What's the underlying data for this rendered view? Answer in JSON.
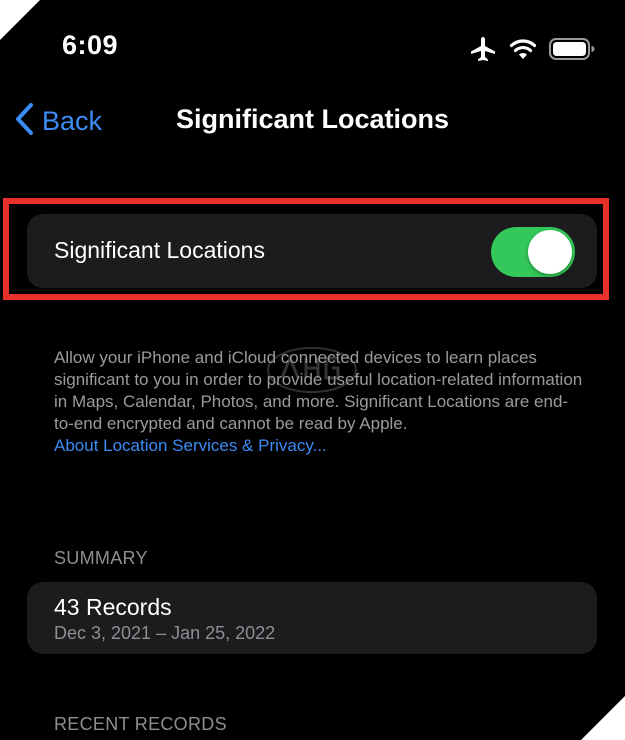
{
  "status_bar": {
    "time": "6:09",
    "icons": [
      "airplane-icon",
      "wifi-icon",
      "battery-icon"
    ]
  },
  "nav": {
    "back_label": "Back",
    "title": "Significant Locations"
  },
  "toggle": {
    "label": "Significant Locations",
    "state": "on",
    "on_color": "#34c759",
    "highlight_color": "#e8302a"
  },
  "description": {
    "text": "Allow your iPhone and iCloud connected devices to learn places significant to you in order to provide useful location-related information in Maps, Calendar, Photos, and more. Significant Locations are end-to-end encrypted and cannot be read by Apple.",
    "link": "About Location Services & Privacy..."
  },
  "summary": {
    "header": "SUMMARY",
    "records": "43 Records",
    "date_range": "Dec 3, 2021 – Jan 25, 2022"
  },
  "recent_records": {
    "header": "RECENT RECORDS"
  },
  "colors": {
    "background": "#000000",
    "cell": "#1c1c1e",
    "accent": "#3b8cf5",
    "secondary_text": "#8e8e93"
  }
}
